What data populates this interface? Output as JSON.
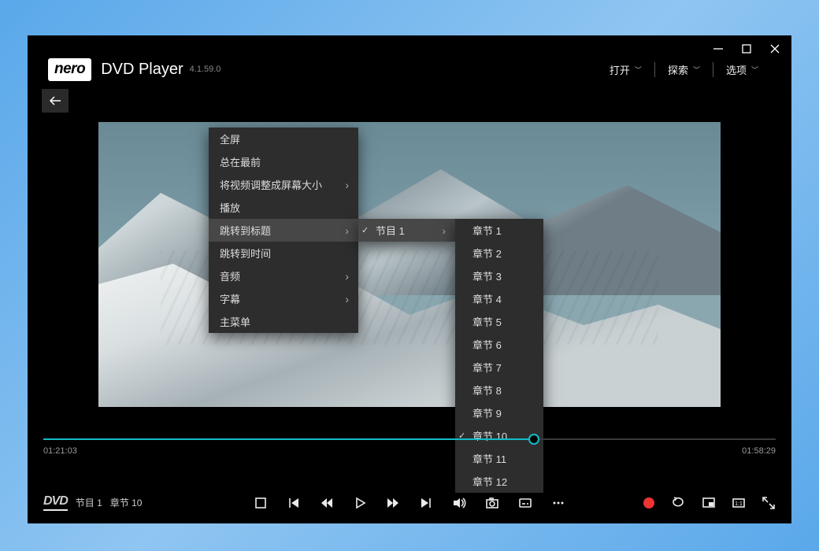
{
  "colors": {
    "accent": "#11bcc6",
    "menu_bg": "#2d2d2d",
    "menu_hover": "#474747",
    "record": "#e33"
  },
  "app": {
    "brand": "nero",
    "title": "DVD Player",
    "version": "4.1.59.0"
  },
  "top_nav": {
    "open": "打开",
    "explore": "探索",
    "options": "选项"
  },
  "context_menu": {
    "items": [
      {
        "label": "全屏",
        "has_sub": false
      },
      {
        "label": "总在最前",
        "has_sub": false
      },
      {
        "label": "将视频调整成屏幕大小",
        "has_sub": true
      },
      {
        "label": "播放",
        "has_sub": false
      },
      {
        "label": "跳转到标题",
        "has_sub": true,
        "hover": true
      },
      {
        "label": "跳转到时间",
        "has_sub": false
      },
      {
        "label": "音频",
        "has_sub": true
      },
      {
        "label": "字幕",
        "has_sub": true
      },
      {
        "label": "主菜单",
        "has_sub": false
      }
    ]
  },
  "title_menu": {
    "items": [
      {
        "label": "节目 1",
        "checked": true,
        "has_sub": true,
        "hover": true
      }
    ]
  },
  "chapter_menu": {
    "items": [
      {
        "label": "章节 1"
      },
      {
        "label": "章节 2"
      },
      {
        "label": "章节 3"
      },
      {
        "label": "章节 4"
      },
      {
        "label": "章节 5"
      },
      {
        "label": "章节 6"
      },
      {
        "label": "章节 7"
      },
      {
        "label": "章节 8"
      },
      {
        "label": "章节 9"
      },
      {
        "label": "章节 10",
        "checked": true
      },
      {
        "label": "章节 11"
      },
      {
        "label": "章节 12"
      }
    ]
  },
  "time": {
    "elapsed": "01:21:03",
    "total": "01:58:29"
  },
  "status": {
    "disc_label": "DVD",
    "title": "节目 1",
    "chapter": "章节 10"
  }
}
